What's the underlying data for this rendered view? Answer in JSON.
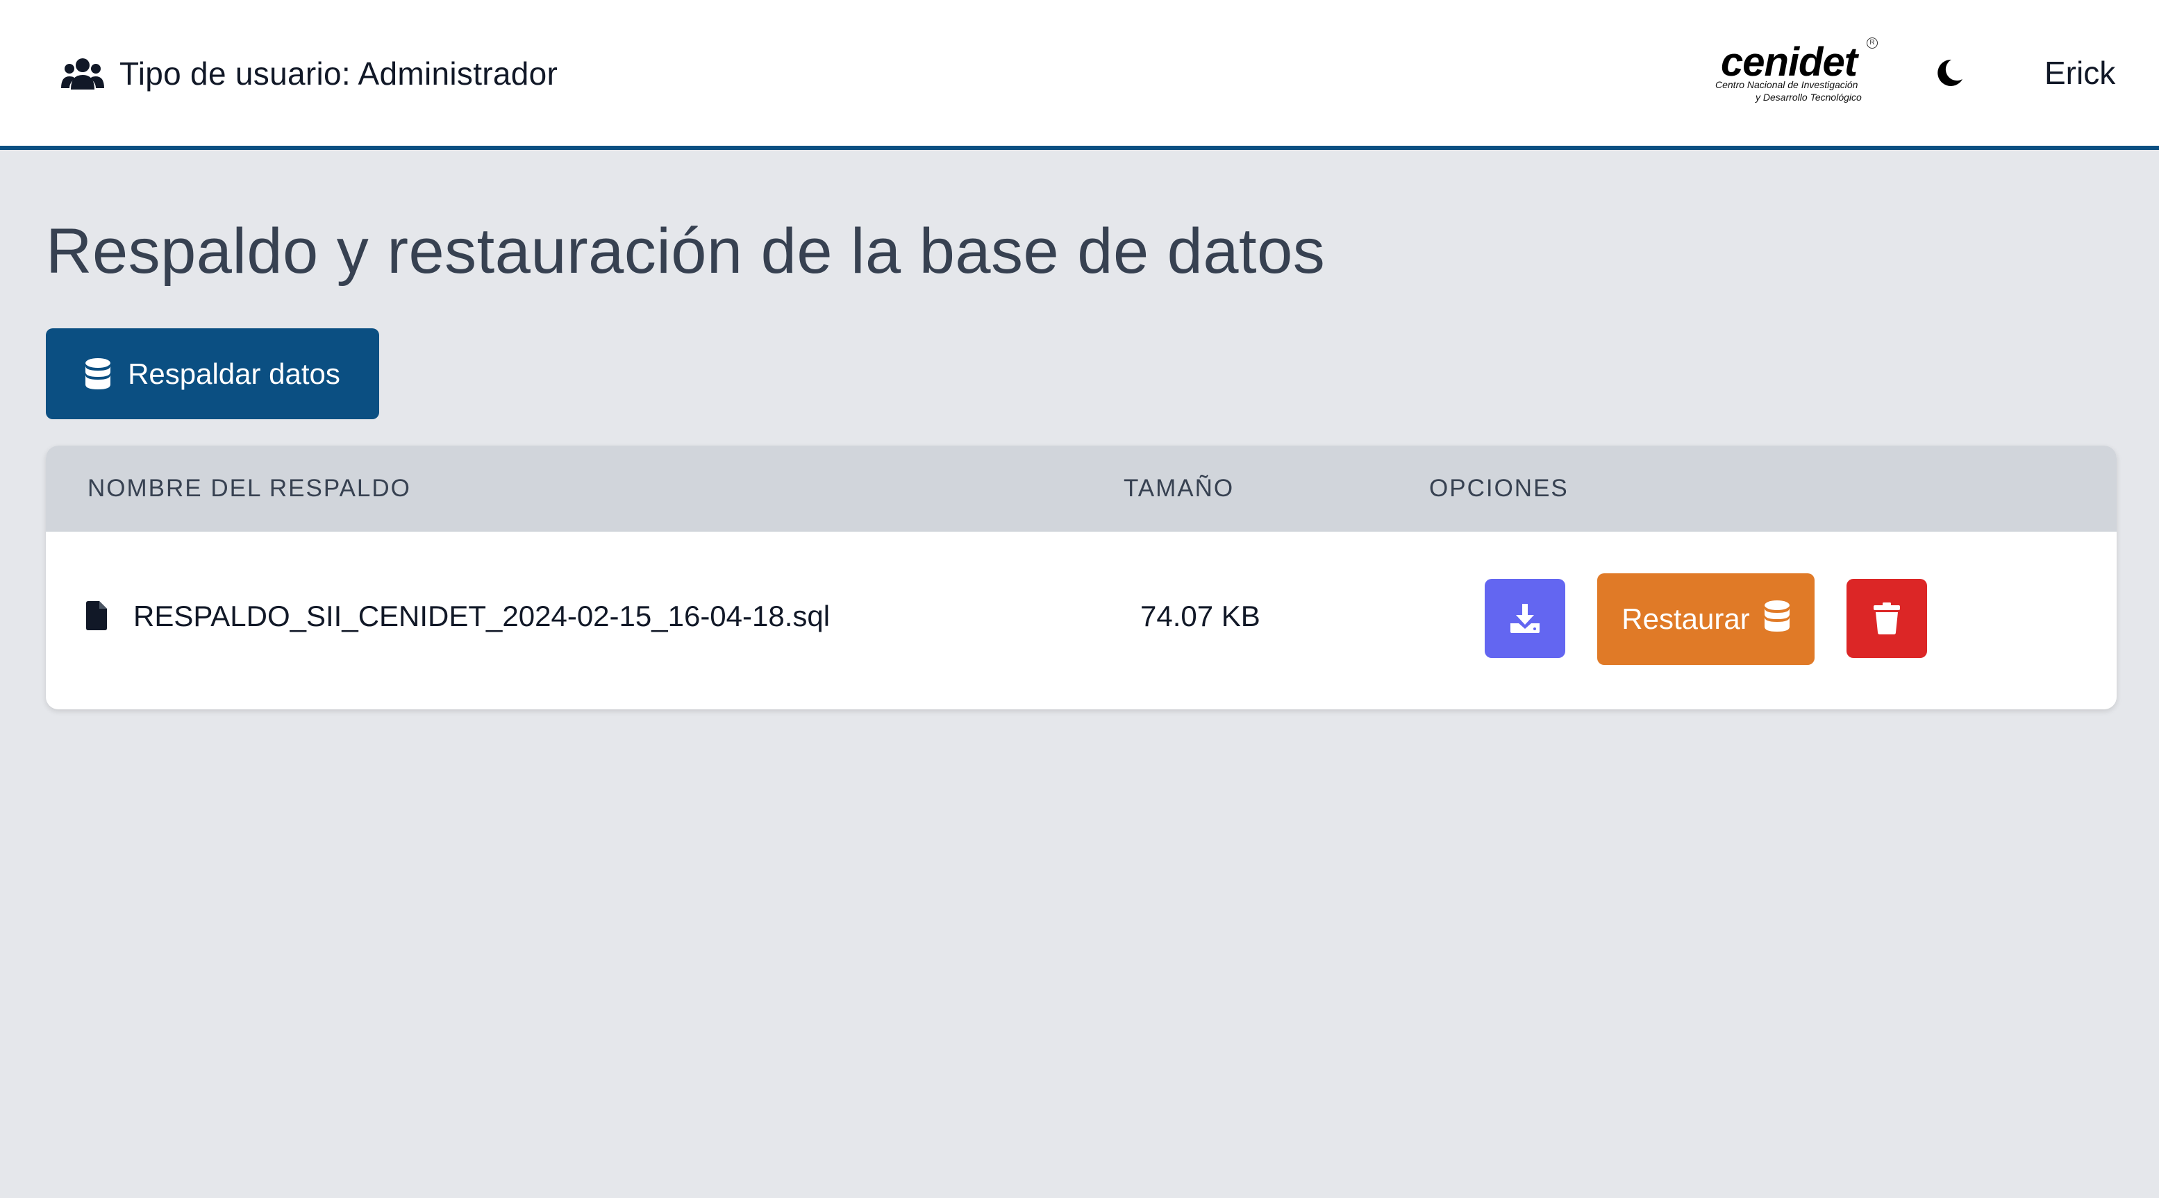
{
  "header": {
    "user_type_label": "Tipo de usuario: Administrador",
    "logo": {
      "name": "cenidet",
      "line1": "Centro Nacional de Investigación",
      "line2": "y Desarrollo Tecnológico"
    },
    "theme_toggle_icon": "moon-icon",
    "username": "Erick"
  },
  "main": {
    "title": "Respaldo y restauración de la base de datos",
    "backup_button_label": "Respaldar datos",
    "table": {
      "columns": [
        "NOMBRE DEL RESPALDO",
        "TAMAÑO",
        "OPCIONES"
      ],
      "rows": [
        {
          "file_name": "RESPALDO_SII_CENIDET_2024-02-15_16-04-18.sql",
          "size": "74.07 KB",
          "restore_label": "Restaurar"
        }
      ]
    }
  },
  "colors": {
    "primary": "#0b4f82",
    "download": "#6366f1",
    "restore": "#e07a27",
    "delete": "#dc2626",
    "background": "#e5e7eb"
  }
}
